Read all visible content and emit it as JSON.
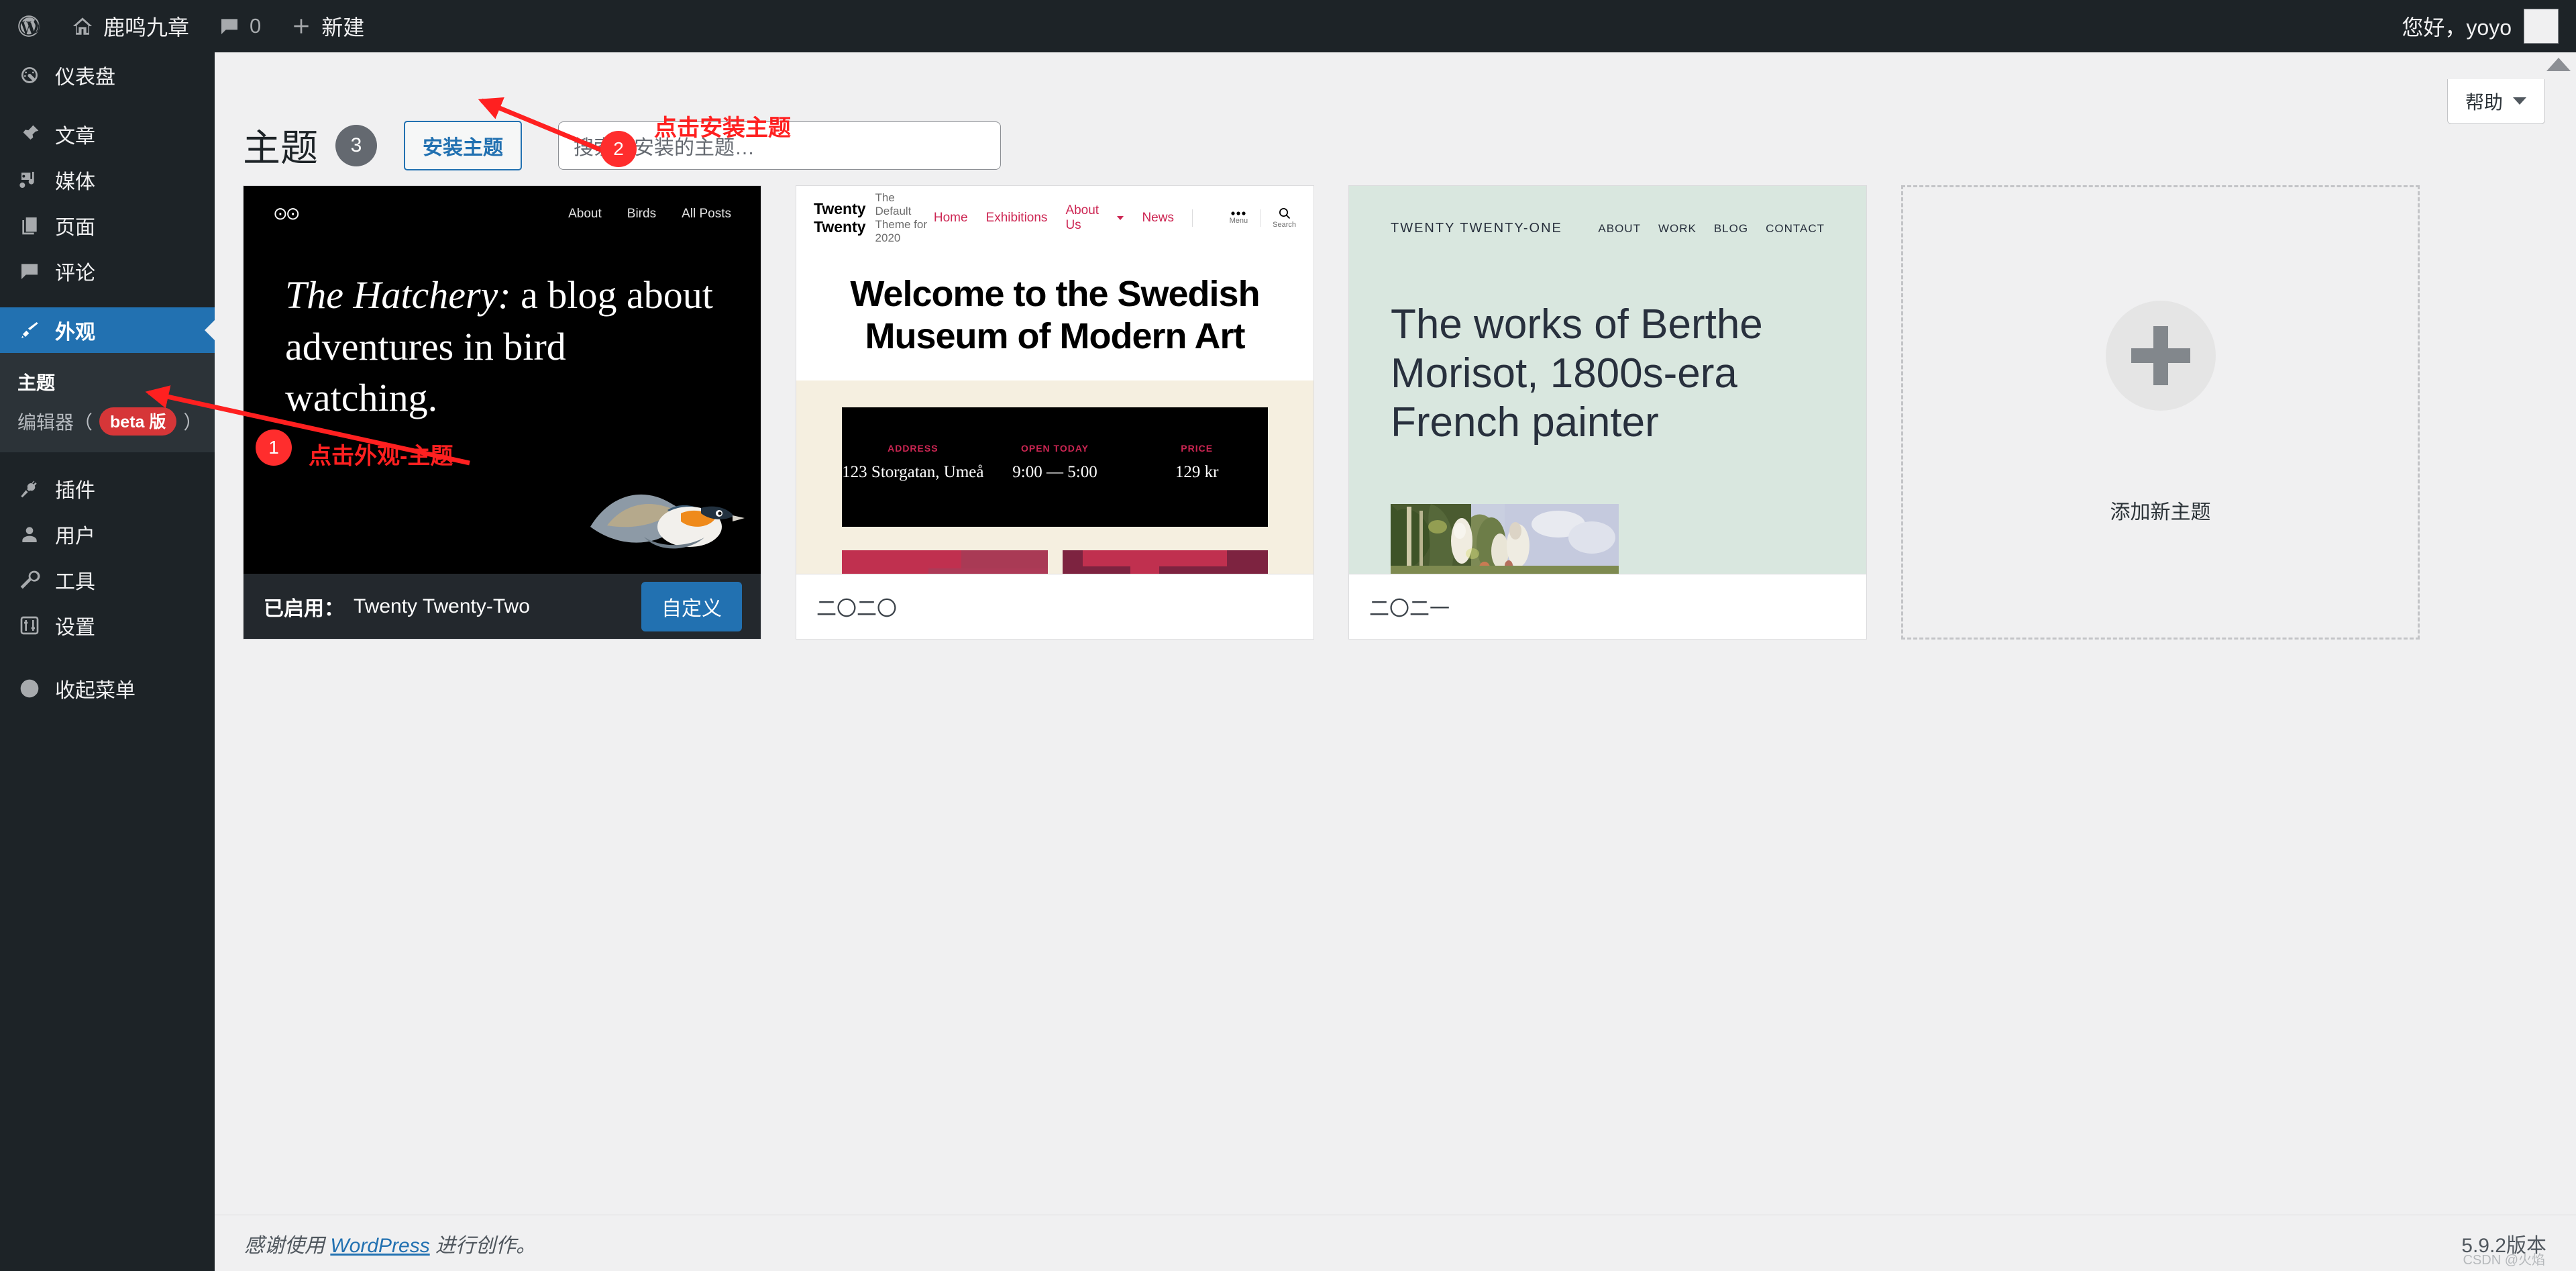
{
  "adminbar": {
    "logo_icon": "wordpress-icon",
    "site_icon": "home-icon",
    "site_name": "鹿鸣九章",
    "comments_icon": "comment-bubble-icon",
    "comments_count": "0",
    "new_icon": "plus-icon",
    "new_label": "新建",
    "greeting": "您好，yoyo",
    "avatar_icon": "avatar-placeholder"
  },
  "sidebar": {
    "items": [
      {
        "label": "仪表盘",
        "icon": "dashboard-icon"
      },
      {
        "label": "文章",
        "icon": "pin-icon"
      },
      {
        "label": "媒体",
        "icon": "media-icon"
      },
      {
        "label": "页面",
        "icon": "page-icon"
      },
      {
        "label": "评论",
        "icon": "comment-icon"
      },
      {
        "label": "外观",
        "icon": "brush-icon"
      },
      {
        "label": "插件",
        "icon": "plug-icon"
      },
      {
        "label": "用户",
        "icon": "user-icon"
      },
      {
        "label": "工具",
        "icon": "wrench-icon"
      },
      {
        "label": "设置",
        "icon": "settings-icon"
      }
    ],
    "submenu": {
      "themes": "主题",
      "editor_prefix": "编辑器（",
      "editor_badge": "beta 版",
      "editor_suffix": "）"
    },
    "collapse": {
      "label": "收起菜单",
      "icon": "collapse-arrow-icon"
    }
  },
  "help": {
    "label": "帮助",
    "chevron_icon": "chevron-down-icon"
  },
  "page": {
    "title": "主题",
    "count": "3",
    "add_theme_button": "安装主题",
    "search_placeholder": "搜索已安装的主题…"
  },
  "themes": [
    {
      "name": "Twenty Twenty-Two",
      "active_label": "已启用：",
      "customize_button": "自定义",
      "is_active": true,
      "preview": {
        "logo": "⊙⊙",
        "nav": [
          "About",
          "Birds",
          "All Posts"
        ],
        "headline_italic": "The Hatchery:",
        "headline_rest": " a blog about adventures in bird watching."
      }
    },
    {
      "name": "二〇二〇",
      "is_active": false,
      "preview": {
        "brand": "Twenty Twenty",
        "tagline": "The Default Theme for 2020",
        "nav": [
          "Home",
          "Exhibitions",
          "About Us",
          "News"
        ],
        "menu_label": "Menu",
        "search_label": "Search",
        "menu_icon": "ellipsis-icon",
        "search_icon": "search-icon",
        "title": "Welcome to the Swedish Museum of Modern Art",
        "info": [
          {
            "label": "ADDRESS",
            "value": "123 Storgatan, Umeå"
          },
          {
            "label": "OPEN TODAY",
            "value": "9:00 — 5:00"
          },
          {
            "label": "PRICE",
            "value": "129 kr"
          }
        ]
      }
    },
    {
      "name": "二〇二一",
      "is_active": false,
      "preview": {
        "brand": "TWENTY TWENTY-ONE",
        "nav": [
          "ABOUT",
          "WORK",
          "BLOG",
          "CONTACT"
        ],
        "title": "The works of Berthe Morisot, 1800s-era French painter"
      }
    }
  ],
  "add_theme_card": {
    "label": "添加新主题",
    "icon": "plus-icon"
  },
  "annotations": [
    {
      "number": "1",
      "text": "点击外观-主题"
    },
    {
      "number": "2",
      "text": "点击安装主题"
    }
  ],
  "footer": {
    "thanks_prefix": "感谢使用 ",
    "thanks_link": "WordPress",
    "thanks_suffix": " 进行创作。",
    "version": "5.9.2版本",
    "watermark": "CSDN @火焰"
  },
  "colors": {
    "accent_blue": "#2271b1",
    "sidebar_dark": "#1d2327",
    "annotation_red": "#ff2020",
    "badge_red": "#d63638"
  }
}
